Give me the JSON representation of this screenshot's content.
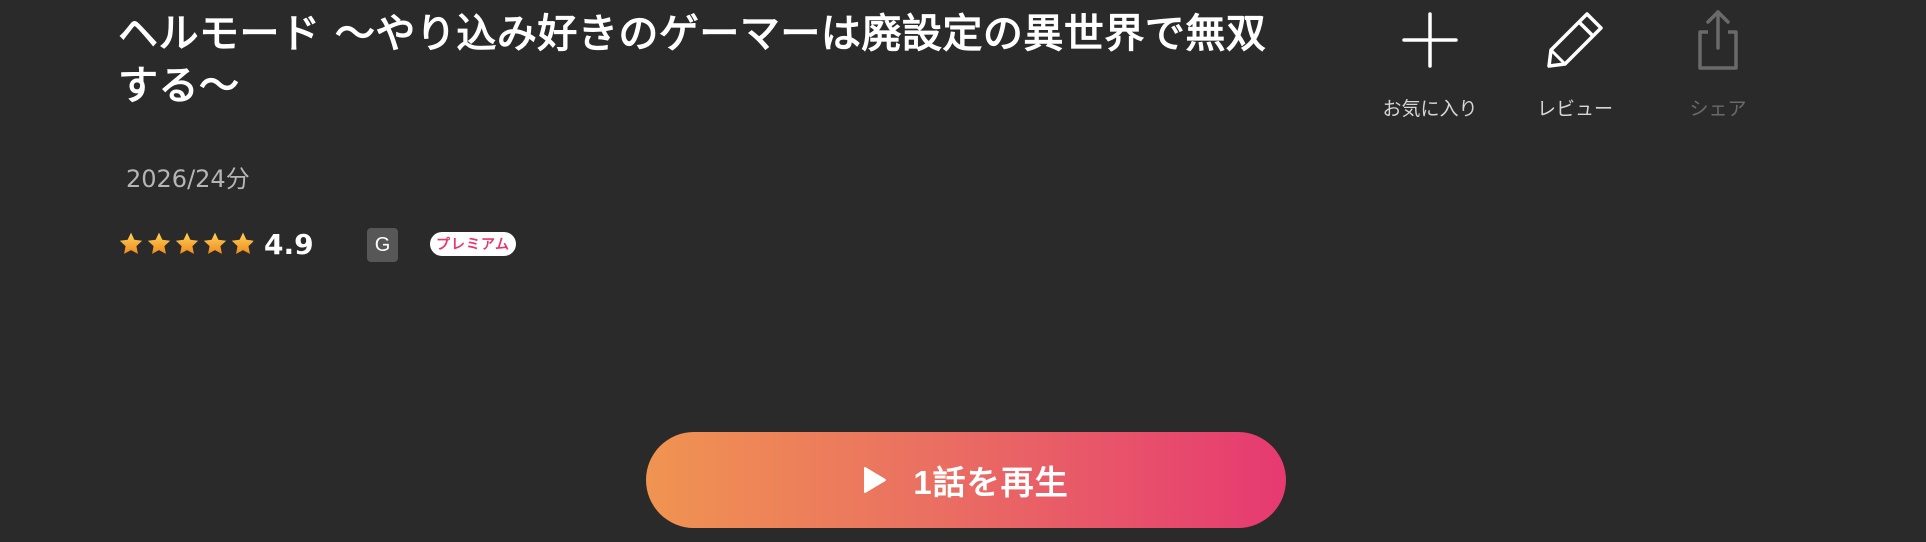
{
  "title": "ヘルモード 〜やり込み好きのゲーマーは廃設定の異世界で無双する〜",
  "meta": "2026/24分",
  "rating": {
    "value": "4.9",
    "stars": 4.9,
    "max_stars": 5
  },
  "age_rating": "G",
  "premium_label": "プレミアム",
  "actions": {
    "favorite": {
      "label": "お気に入り",
      "icon": "plus-icon"
    },
    "review": {
      "label": "レビュー",
      "icon": "pencil-icon"
    },
    "share": {
      "label": "シェア",
      "icon": "share-icon",
      "enabled": false
    }
  },
  "play": {
    "label": "1話を再生",
    "icon": "play-icon"
  },
  "colors": {
    "background": "#2a2a2a",
    "star": "#f5a623",
    "play_gradient_start": "#f09451",
    "play_gradient_end": "#e63971",
    "premium_text": "#e23a6d"
  }
}
